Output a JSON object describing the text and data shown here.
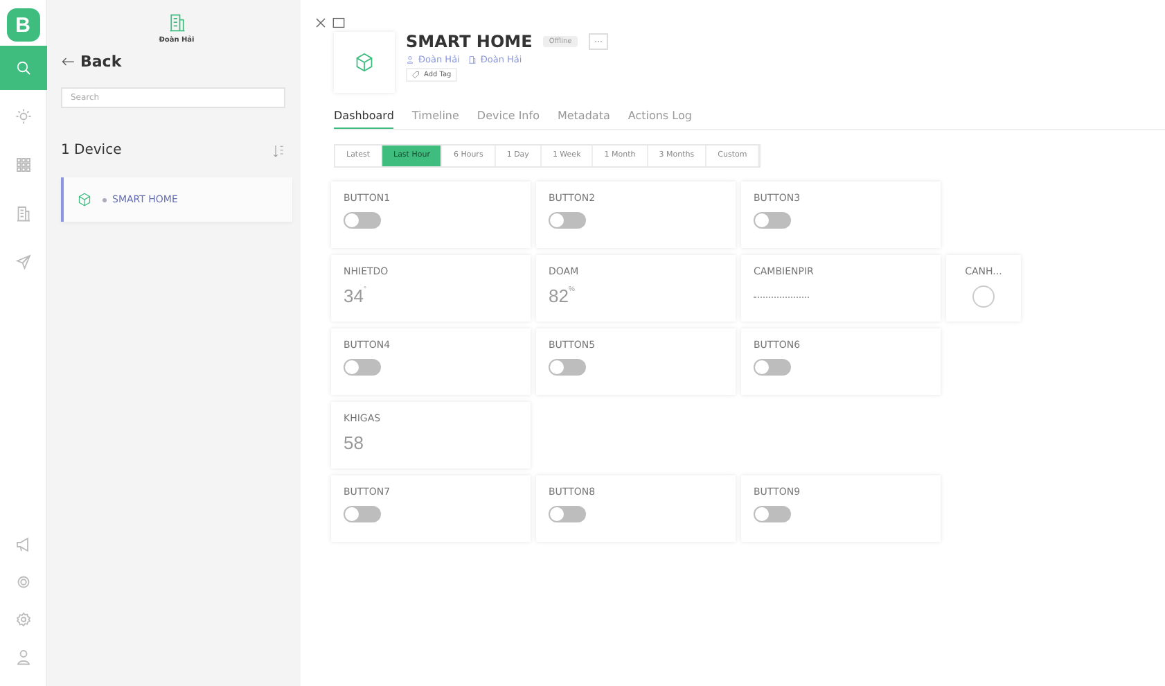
{
  "rail": {
    "logo": "B",
    "items": [
      {
        "kind": "search",
        "selected": true
      },
      {
        "kind": "bulb",
        "selected": false
      },
      {
        "kind": "grid",
        "selected": false
      },
      {
        "kind": "building",
        "selected": false
      },
      {
        "kind": "send",
        "selected": false
      }
    ],
    "bottom": [
      {
        "kind": "megaphone"
      },
      {
        "kind": "gear-ring"
      },
      {
        "kind": "settings"
      },
      {
        "kind": "user"
      }
    ]
  },
  "panel": {
    "org": "Đoàn Hải",
    "back": "Back",
    "search": {
      "placeholder": "Search"
    },
    "count": "1 Device",
    "devices": [
      {
        "name": "SMART HOME",
        "selected": true
      }
    ]
  },
  "device": {
    "name": "SMART HOME",
    "status": "Offline",
    "owner": "Đoàn Hải",
    "org": "Đoàn Hải",
    "add_tag": "Add Tag"
  },
  "tabs": [
    {
      "label": "Dashboard",
      "selected": true
    },
    {
      "label": "Timeline",
      "selected": false
    },
    {
      "label": "Device Info",
      "selected": false
    },
    {
      "label": "Metadata",
      "selected": false
    },
    {
      "label": "Actions Log",
      "selected": false
    }
  ],
  "ranges": [
    {
      "label": "Latest",
      "selected": false
    },
    {
      "label": "Last Hour",
      "selected": true
    },
    {
      "label": "6 Hours",
      "selected": false
    },
    {
      "label": "1 Day",
      "selected": false
    },
    {
      "label": "1 Week",
      "selected": false
    },
    {
      "label": "1 Month",
      "selected": false
    },
    {
      "label": "3 Months",
      "selected": false
    },
    {
      "label": "Custom",
      "selected": false
    }
  ],
  "widget_rows": [
    [
      {
        "kind": "switch",
        "title": "BUTTON1",
        "on": false
      },
      {
        "kind": "switch",
        "title": "BUTTON2",
        "on": false
      },
      {
        "kind": "switch",
        "title": "BUTTON3",
        "on": false
      }
    ],
    [
      {
        "kind": "value",
        "title": "NHIETDO",
        "value": "34",
        "unit": "°"
      },
      {
        "kind": "value",
        "title": "DOAM",
        "value": "82",
        "unit": "%"
      },
      {
        "kind": "dots",
        "title": "CAMBIENPIR"
      },
      {
        "kind": "led",
        "title": "CANH...",
        "on": false
      }
    ],
    [
      {
        "kind": "switch",
        "title": "BUTTON4",
        "on": false
      },
      {
        "kind": "switch",
        "title": "BUTTON5",
        "on": false
      },
      {
        "kind": "switch",
        "title": "BUTTON6",
        "on": false
      }
    ],
    [
      {
        "kind": "value",
        "title": "KHIGAS",
        "value": "58"
      }
    ],
    [
      {
        "kind": "switch",
        "title": "BUTTON7",
        "on": false
      },
      {
        "kind": "switch",
        "title": "BUTTON8",
        "on": false
      },
      {
        "kind": "switch",
        "title": "BUTTON9",
        "on": false
      }
    ]
  ]
}
